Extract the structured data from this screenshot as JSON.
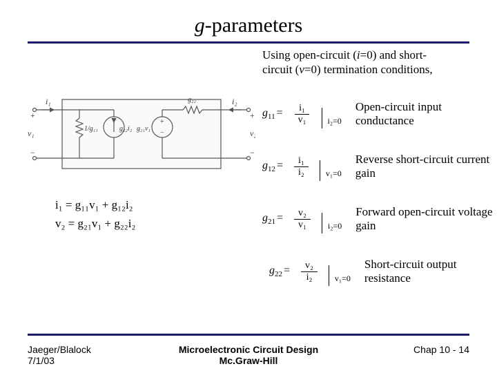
{
  "title_prefix": "g",
  "title_rest": "-parameters",
  "intro": "Using open-circuit (i=0) and short-circuit (v=0) termination conditions,",
  "eq1": "i₁ = g₁₁v₁ + g₁₂i₂",
  "eq2": "v₂ = g₂₁v₁ + g₂₂i₂",
  "params": [
    {
      "g": "g",
      "sub": "11",
      "num": "i₁",
      "den": "v₁",
      "cond": "i₂=0",
      "desc": "Open-circuit input conductance"
    },
    {
      "g": "g",
      "sub": "12",
      "num": "i₁",
      "den": "i₂",
      "cond": "v₁=0",
      "desc": "Reverse short-circuit current gain"
    },
    {
      "g": "g",
      "sub": "21",
      "num": "v₂",
      "den": "v₁",
      "cond": "i₂=0",
      "desc": "Forward open-circuit voltage gain"
    },
    {
      "g": "g",
      "sub": "22",
      "num": "v₂",
      "den": "i₂",
      "cond": "v₁=0",
      "desc": "Short-circuit output resistance"
    }
  ],
  "footer": {
    "author": "Jaeger/Blalock",
    "date": "7/1/03",
    "book1": "Microelectronic Circuit Design",
    "book2": "Mc.Graw-Hill",
    "page": "Chap 10 - 14"
  },
  "circuit": {
    "i1": "i₁",
    "i2": "i₂",
    "v1": "v₁",
    "v2": "v₂",
    "r1": "1/g₁₁",
    "cs": "g₁₂i₂",
    "vs": "g₂₁v₁",
    "r2": "g₂₂"
  }
}
